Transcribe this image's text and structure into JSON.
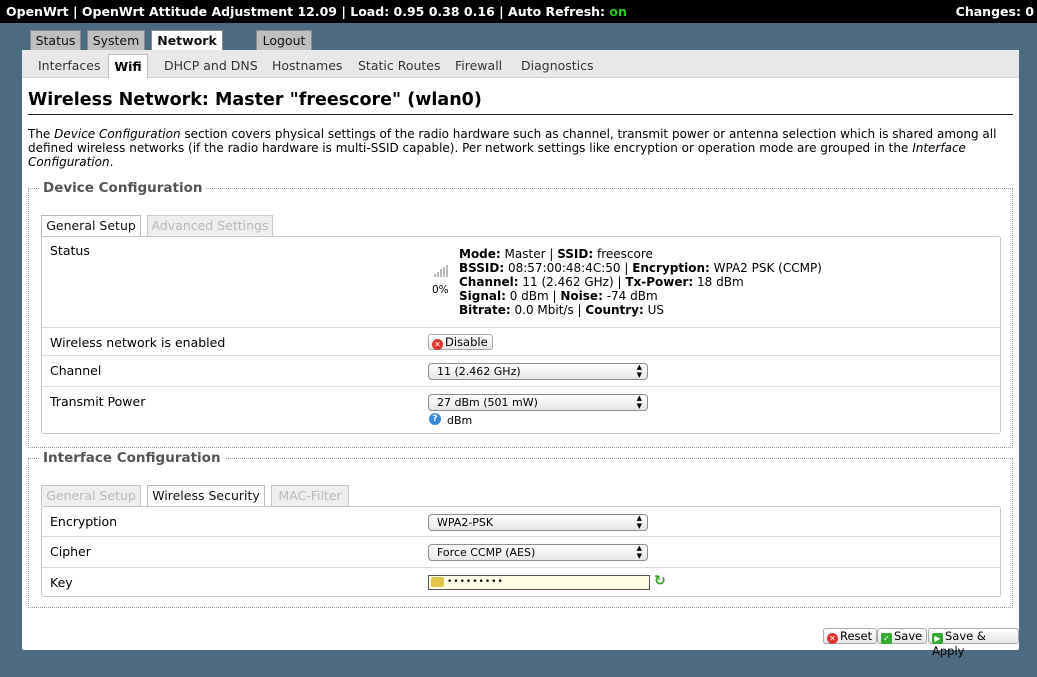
{
  "topbar": {
    "text": "OpenWrt | OpenWrt Attitude Adjustment 12.09 | Load: 0.95 0.38 0.16 | Auto Refresh: ",
    "refresh_state": "on",
    "changes": "Changes: 0"
  },
  "main_tabs": [
    "Status",
    "System",
    "Network",
    "Logout"
  ],
  "sub_tabs": [
    "Interfaces",
    "Wifi",
    "DHCP and DNS",
    "Hostnames",
    "Static Routes",
    "Firewall",
    "Diagnostics"
  ],
  "page": {
    "title": "Wireless Network: Master \"freescore\" (wlan0)",
    "desc_1": "The ",
    "desc_em1": "Device Configuration",
    "desc_2": " section covers physical settings of the radio hardware such as channel, transmit power or antenna selection which is shared among all defined wireless networks (if the radio hardware is multi-SSID capable). Per network settings like encryption or operation mode are grouped in the ",
    "desc_em2": "Interface Configuration",
    "desc_3": "."
  },
  "device": {
    "legend": "Device Configuration",
    "tabs": [
      "General Setup",
      "Advanced Settings"
    ],
    "status_label": "Status",
    "signal_pct": "0%",
    "status": {
      "mode_k": "Mode:",
      "mode_v": " Master | ",
      "ssid_k": "SSID:",
      "ssid_v": " freescore",
      "bssid_k": "BSSID:",
      "bssid_v": " 08:57:00:48:4C:50 | ",
      "enc_k": "Encryption:",
      "enc_v": " WPA2 PSK (CCMP)",
      "chan_k": "Channel:",
      "chan_v": " 11 (2.462 GHz) | ",
      "txp_k": "Tx-Power:",
      "txp_v": " 18 dBm",
      "sig_k": "Signal:",
      "sig_v": " 0 dBm | ",
      "noise_k": "Noise:",
      "noise_v": " -74 dBm",
      "bitrate_k": "Bitrate:",
      "bitrate_v": " 0.0 Mbit/s | ",
      "country_k": "Country:",
      "country_v": " US"
    },
    "enabled_label": "Wireless network is enabled",
    "disable_button": "Disable",
    "channel_label": "Channel",
    "channel_value": "11 (2.462 GHz)",
    "txpower_label": "Transmit Power",
    "txpower_value": "27 dBm (501 mW)",
    "txpower_unit": "dBm"
  },
  "interface": {
    "legend": "Interface Configuration",
    "tabs": [
      "General Setup",
      "Wireless Security",
      "MAC-Filter"
    ],
    "encryption_label": "Encryption",
    "encryption_value": "WPA2-PSK",
    "cipher_label": "Cipher",
    "cipher_value": "Force CCMP (AES)",
    "key_label": "Key",
    "key_value": "•••••••••"
  },
  "actions": {
    "reset": "Reset",
    "save": "Save",
    "save_apply": "Save & Apply"
  },
  "colors": {
    "background": "#4c6b7f",
    "topbar": "#000000",
    "refresh_on": "#22cc22"
  }
}
